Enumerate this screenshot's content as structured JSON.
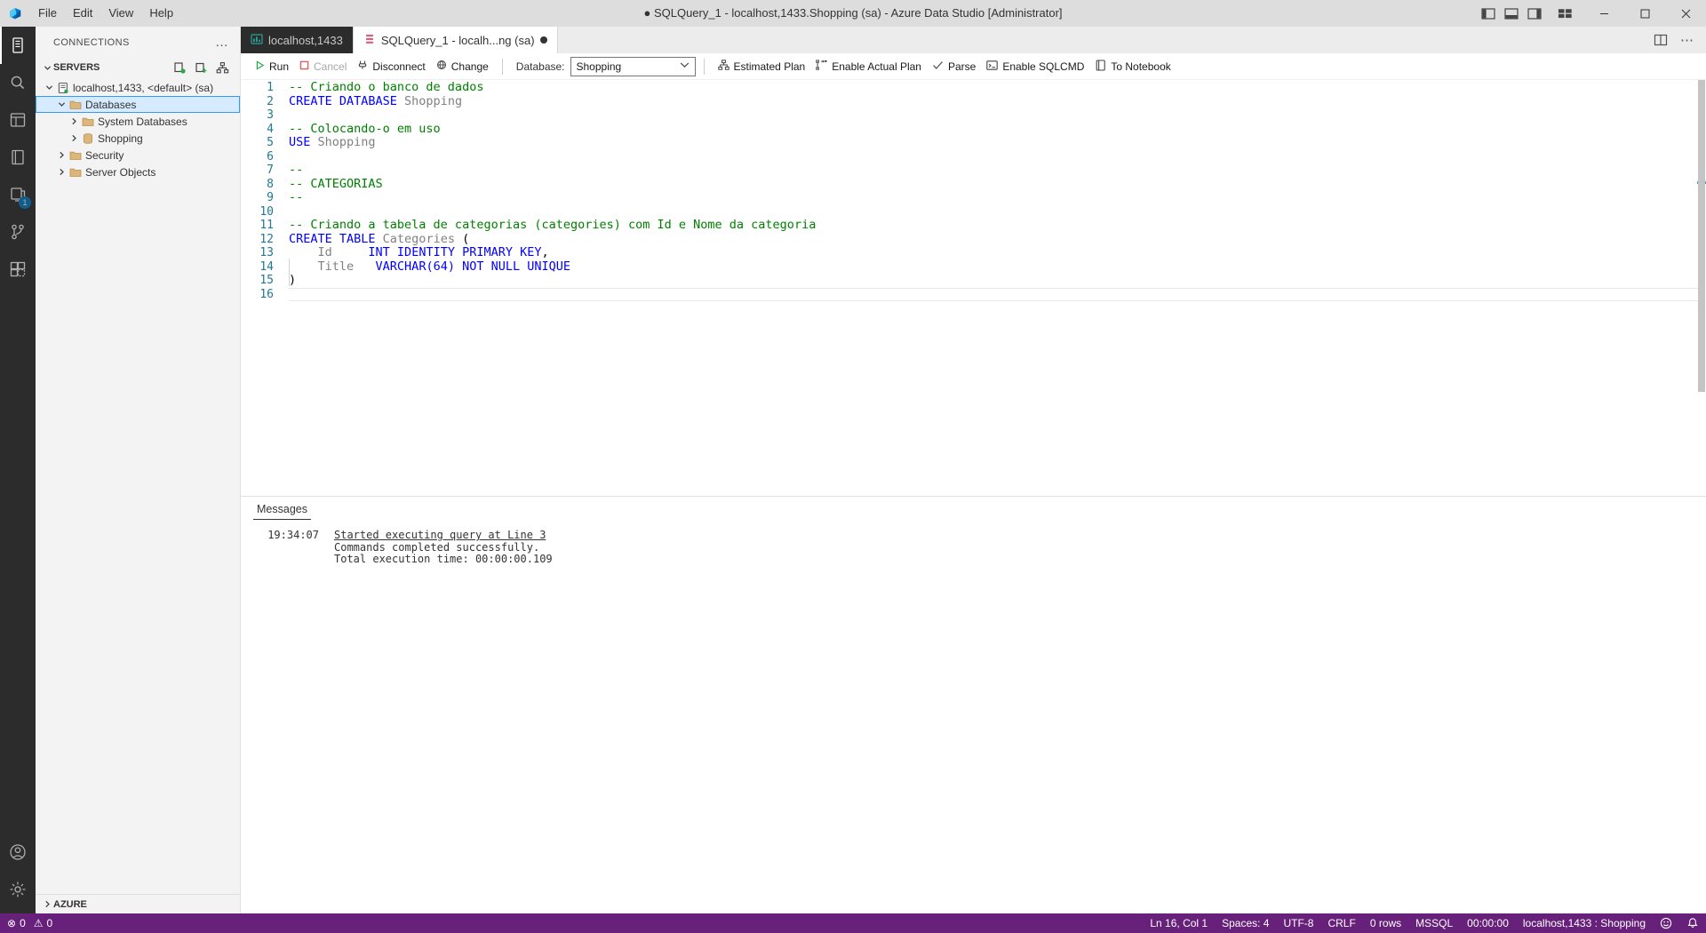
{
  "window": {
    "title": "SQLQuery_1 - localhost,1433.Shopping (sa) - Azure Data Studio [Administrator]",
    "dirty_marker": "●",
    "menus": [
      "File",
      "Edit",
      "View",
      "Help"
    ],
    "minimize": "–",
    "maximize": "⬜",
    "close": "✕"
  },
  "sidebar": {
    "title": "CONNECTIONS",
    "overflow": "…",
    "section": {
      "label": "SERVERS",
      "chevron": "⌄"
    },
    "tree": [
      {
        "label": "localhost,1433, <default> (sa)",
        "depth": 0,
        "expanded": true,
        "icon": "server-icon",
        "selected": false
      },
      {
        "label": "Databases",
        "depth": 1,
        "expanded": true,
        "icon": "folder-icon",
        "selected": true
      },
      {
        "label": "System Databases",
        "depth": 2,
        "expanded": false,
        "icon": "folder-icon",
        "selected": false
      },
      {
        "label": "Shopping",
        "depth": 2,
        "expanded": false,
        "icon": "database-icon",
        "selected": false
      },
      {
        "label": "Security",
        "depth": 1,
        "expanded": false,
        "icon": "folder-icon",
        "selected": false
      },
      {
        "label": "Server Objects",
        "depth": 1,
        "expanded": false,
        "icon": "folder-icon",
        "selected": false
      }
    ],
    "footer": {
      "label": "AZURE",
      "chevron": "›"
    }
  },
  "activitybar": {
    "items": [
      {
        "name": "servers-icon",
        "active": true,
        "badge": null
      },
      {
        "name": "search-icon",
        "active": false,
        "badge": null
      },
      {
        "name": "source-control-explorer-icon",
        "active": false,
        "badge": null
      },
      {
        "name": "notebooks-icon",
        "active": false,
        "badge": null
      },
      {
        "name": "extensions-marketplace-icon",
        "active": false,
        "badge": "1"
      },
      {
        "name": "source-control-icon",
        "active": false,
        "badge": null
      },
      {
        "name": "extensions-icon",
        "active": false,
        "badge": null
      }
    ],
    "bottom": [
      {
        "name": "accounts-icon"
      },
      {
        "name": "manage-settings-icon"
      }
    ]
  },
  "tabs": [
    {
      "label": "localhost,1433",
      "active": false,
      "dirty": false,
      "icon": "dashboard-icon"
    },
    {
      "label": "SQLQuery_1 - localh...ng (sa)",
      "active": true,
      "dirty": true,
      "icon": "query-file-icon"
    }
  ],
  "editor_actions": [
    {
      "name": "split-editor-icon"
    },
    {
      "name": "more-actions-icon",
      "glyph": "⋯"
    }
  ],
  "query_toolbar": {
    "run": "Run",
    "cancel": "Cancel",
    "disconnect": "Disconnect",
    "change": "Change",
    "database_label": "Database:",
    "database_value": "Shopping",
    "database_caret": "⌄",
    "estimated_plan": "Estimated Plan",
    "enable_actual_plan": "Enable Actual Plan",
    "parse": "Parse",
    "enable_sqlcmd": "Enable SQLCMD",
    "to_notebook": "To Notebook"
  },
  "code": {
    "language": "sql",
    "line_count": 16,
    "cursor_line": 16,
    "lines": [
      {
        "n": 1,
        "tokens": [
          {
            "t": "-- Criando o banco de dados",
            "c": "comment"
          }
        ]
      },
      {
        "n": 2,
        "tokens": [
          {
            "t": "CREATE DATABASE ",
            "c": "key"
          },
          {
            "t": "Shopping",
            "c": "ident"
          }
        ]
      },
      {
        "n": 3,
        "tokens": []
      },
      {
        "n": 4,
        "tokens": [
          {
            "t": "-- Colocando-o em uso",
            "c": "comment"
          }
        ]
      },
      {
        "n": 5,
        "tokens": [
          {
            "t": "USE ",
            "c": "key"
          },
          {
            "t": "Shopping",
            "c": "ident"
          }
        ]
      },
      {
        "n": 6,
        "tokens": []
      },
      {
        "n": 7,
        "tokens": [
          {
            "t": "--",
            "c": "comment"
          }
        ]
      },
      {
        "n": 8,
        "tokens": [
          {
            "t": "-- CATEGORIAS",
            "c": "comment"
          }
        ]
      },
      {
        "n": 9,
        "tokens": [
          {
            "t": "--",
            "c": "comment"
          }
        ]
      },
      {
        "n": 10,
        "tokens": []
      },
      {
        "n": 11,
        "tokens": [
          {
            "t": "-- Criando a tabela de categorias (categories) com Id e Nome da categoria",
            "c": "comment"
          }
        ]
      },
      {
        "n": 12,
        "tokens": [
          {
            "t": "CREATE TABLE ",
            "c": "key"
          },
          {
            "t": "Categories ",
            "c": "ident"
          },
          {
            "t": "(",
            "c": "plain"
          }
        ]
      },
      {
        "n": 13,
        "tokens": [
          {
            "t": "    ",
            "c": "plain"
          },
          {
            "t": "Id",
            "c": "ident"
          },
          {
            "t": "     ",
            "c": "plain"
          },
          {
            "t": "INT IDENTITY PRIMARY KEY",
            "c": "key"
          },
          {
            "t": ",",
            "c": "plain"
          }
        ]
      },
      {
        "n": 14,
        "tokens": [
          {
            "t": "    ",
            "c": "plain"
          },
          {
            "t": "Title",
            "c": "ident"
          },
          {
            "t": "   ",
            "c": "plain"
          },
          {
            "t": "VARCHAR(64) NOT NULL UNIQUE",
            "c": "key"
          }
        ]
      },
      {
        "n": 15,
        "tokens": [
          {
            "t": ")",
            "c": "plain"
          }
        ]
      },
      {
        "n": 16,
        "tokens": []
      }
    ]
  },
  "results": {
    "tab_label": "Messages",
    "messages": [
      {
        "time": "19:34:07",
        "text": "Started executing query at Line 3",
        "link": true
      },
      {
        "time": "",
        "text": "Commands completed successfully.",
        "link": false
      },
      {
        "time": "",
        "text": "Total execution time: 00:00:00.109",
        "link": false
      }
    ]
  },
  "statusbar": {
    "errors": "0",
    "warnings": "0",
    "error_icon": "⊗",
    "warning_icon": "⚠",
    "cursor_position": "Ln 16, Col 1",
    "indentation": "Spaces: 4",
    "encoding": "UTF-8",
    "eol": "CRLF",
    "rows": "0 rows",
    "language": "MSSQL",
    "exec_time": "00:00:00",
    "connection": "localhost,1433 : Shopping",
    "feedback_icon": "feedback-smiley-icon",
    "bell_icon": "notifications-bell-icon"
  },
  "colors": {
    "status_bar": "#68217a",
    "activity_bar": "#2c2c2c",
    "title_bar": "#dddddd",
    "sidebar": "#f3f3f3",
    "selection": "#d6ebff",
    "comment": "#008000",
    "keyword": "#0000ff",
    "identifier": "#808080",
    "badge": "#007acc",
    "accent_pink": "#e25a7c",
    "accent_green": "#2aa198"
  }
}
